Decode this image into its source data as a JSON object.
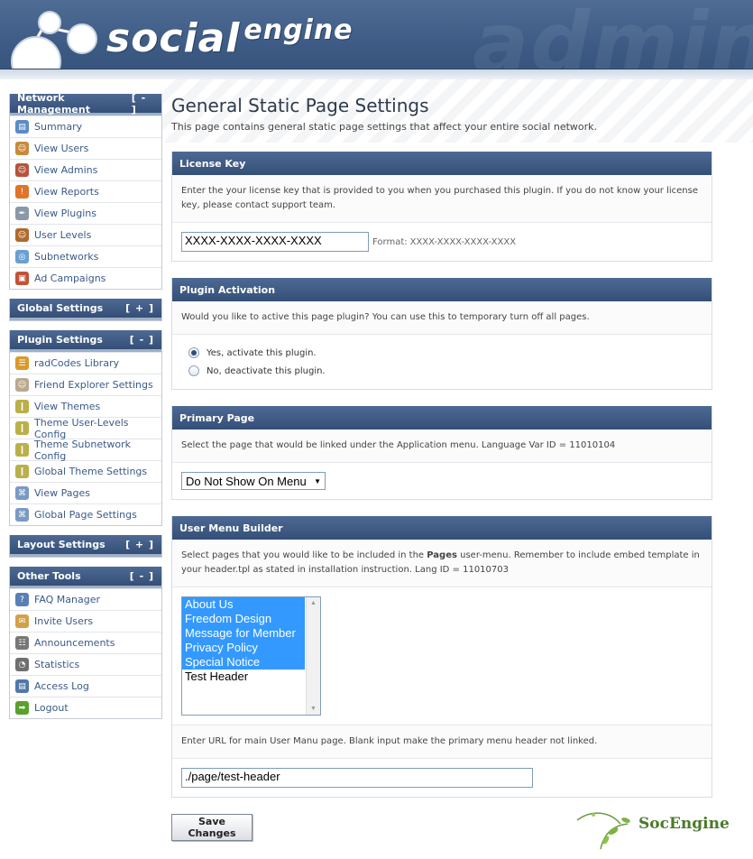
{
  "header": {
    "logo_main": "social",
    "logo_sup": "engine",
    "watermark": "admin"
  },
  "sidebar": {
    "groups": [
      {
        "title": "Network Management",
        "toggle": "[ - ]",
        "items": [
          {
            "label": "Summary",
            "icon": "summary-icon"
          },
          {
            "label": "View Users",
            "icon": "user-icon"
          },
          {
            "label": "View Admins",
            "icon": "admin-icon"
          },
          {
            "label": "View Reports",
            "icon": "report-icon"
          },
          {
            "label": "View Plugins",
            "icon": "plugin-icon"
          },
          {
            "label": "User Levels",
            "icon": "user-levels-icon"
          },
          {
            "label": "Subnetworks",
            "icon": "globe-icon"
          },
          {
            "label": "Ad Campaigns",
            "icon": "ad-campaigns-icon"
          }
        ]
      },
      {
        "title": "Global Settings",
        "toggle": "[ + ]",
        "items": []
      },
      {
        "title": "Plugin Settings",
        "toggle": "[ - ]",
        "items": [
          {
            "label": "radCodes Library",
            "icon": "library-icon"
          },
          {
            "label": "Friend Explorer Settings",
            "icon": "friends-icon"
          },
          {
            "label": "View Themes",
            "icon": "theme-icon"
          },
          {
            "label": "Theme User-Levels Config",
            "icon": "theme-icon"
          },
          {
            "label": "Theme Subnetwork Config",
            "icon": "theme-icon"
          },
          {
            "label": "Global Theme Settings",
            "icon": "theme-icon"
          },
          {
            "label": "View Pages",
            "icon": "page-icon"
          },
          {
            "label": "Global Page Settings",
            "icon": "page-icon"
          }
        ]
      },
      {
        "title": "Layout Settings",
        "toggle": "[ + ]",
        "items": []
      },
      {
        "title": "Other Tools",
        "toggle": "[ - ]",
        "items": [
          {
            "label": "FAQ Manager",
            "icon": "help-icon"
          },
          {
            "label": "Invite Users",
            "icon": "invite-icon"
          },
          {
            "label": "Announcements",
            "icon": "calendar-icon"
          },
          {
            "label": "Statistics",
            "icon": "statistics-icon"
          },
          {
            "label": "Access Log",
            "icon": "log-icon"
          },
          {
            "label": "Logout",
            "icon": "logout-icon"
          }
        ]
      }
    ]
  },
  "main": {
    "title": "General Static Page Settings",
    "description": "This page contains general static page settings that affect your entire social network.",
    "license": {
      "heading": "License Key",
      "desc": "Enter the your license key that is provided to you when you purchased this plugin. If you do not know your license key, please contact support team.",
      "value": "XXXX-XXXX-XXXX-XXXX",
      "format_label": "Format:",
      "format_value": "XXXX-XXXX-XXXX-XXXX"
    },
    "activation": {
      "heading": "Plugin Activation",
      "desc": "Would you like to active this page plugin? You can use this to temporary turn off all pages.",
      "option_yes": "Yes, activate this plugin.",
      "option_no": "No, deactivate this plugin.",
      "selected": "yes"
    },
    "primary": {
      "heading": "Primary Page",
      "desc": "Select the page that would be linked under the Application menu. Language Var ID = 11010104",
      "selected": "Do Not Show On Menu"
    },
    "usermenu": {
      "heading": "User Menu Builder",
      "desc_pre": "Select pages that you would like to be included in the ",
      "desc_bold": "Pages",
      "desc_post": " user-menu. Remember to include embed template in your header.tpl as stated in installation instruction. Lang ID = 11010703",
      "options": [
        {
          "label": "About Us",
          "selected": true
        },
        {
          "label": "Freedom Design",
          "selected": true
        },
        {
          "label": "Message for Member",
          "selected": true
        },
        {
          "label": "Privacy Policy",
          "selected": true
        },
        {
          "label": "Special Notice",
          "selected": true
        },
        {
          "label": "Test Header",
          "selected": false
        }
      ],
      "url_desc": "Enter URL for main User Manu page. Blank input make the primary menu header not linked.",
      "url_value": "./page/test-header"
    },
    "save_label": "Save Changes",
    "footer_logo": "SocEngine"
  }
}
